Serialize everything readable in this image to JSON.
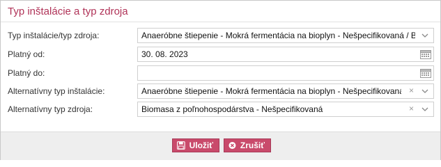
{
  "dialog": {
    "title": "Typ inštalácie a typ zdroja"
  },
  "form": {
    "fields": [
      {
        "label": "Typ inštalácie/typ zdroja:",
        "value": "Anaeróbne štiepenie - Mokrá fermentácia na bioplyn - Nešpecifikovaná / Bioplyn",
        "control": "select",
        "clearable": false
      },
      {
        "label": "Platný od:",
        "value": "30. 08. 2023",
        "control": "date"
      },
      {
        "label": "Platný do:",
        "value": "",
        "control": "date"
      },
      {
        "label": "Alternatívny typ inštalácie:",
        "value": "Anaeróbne štiepenie - Mokrá fermentácia na bioplyn - Nešpecifikovaná",
        "control": "select",
        "clearable": true
      },
      {
        "label": "Alternatívny typ zdroja:",
        "value": "Biomasa z poľnohospodárstva - Nešpecifikovaná",
        "control": "select",
        "clearable": true
      }
    ],
    "clear_glyph": "×",
    "icons": {
      "dropdown": "chevron-down-icon",
      "calendar": "calendar-icon",
      "save": "save-icon",
      "cancel": "cancel-icon"
    }
  },
  "footer": {
    "save_label": "Uložiť",
    "cancel_label": "Zrušiť"
  },
  "colors": {
    "accent": "#c94a6b",
    "title": "#b03358"
  }
}
